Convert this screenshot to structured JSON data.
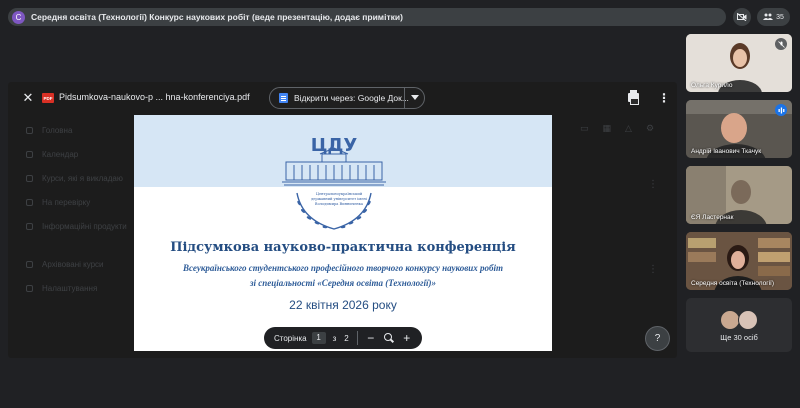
{
  "meeting": {
    "avatar_letter": "С",
    "title": "Середня освіта (Технології) Конкурс наукових робіт (веде презентацію, додає примітки)",
    "participant_count": "35"
  },
  "background": {
    "items": [
      "Головна",
      "Календар",
      "Курси, які я викладаю",
      "На перевірку",
      "Інформаційні продукти",
      "Архівовані курси",
      "Налаштування"
    ]
  },
  "viewer": {
    "filename": "Pidsumkova-naukovo-p ... hna-konferenciya.pdf",
    "pdf_badge": "PDF",
    "open_with": "Відкрити через: Google Док...",
    "page_label": "Сторінка",
    "current_page": "1",
    "of_label": "з",
    "total_pages": "2",
    "minus": "−",
    "plus": "+",
    "help": "?"
  },
  "slide": {
    "logo_text": "ЦДУ",
    "logo_caption_1": "Центральноукраїнський",
    "logo_caption_2": "державний університет імені",
    "logo_caption_3": "Володимира Винниченка",
    "title": "Підсумкова науково-практична конференція",
    "subtitle_1": "Всеукраїнського студентського професійного творчого конкурсу наукових робіт",
    "subtitle_2": "зі спеціальності «Середня освіта (Технології)»",
    "date": "22 квітня 2026 року"
  },
  "participants": [
    {
      "name": "Ольга Курило",
      "bg": "#dcd6cf"
    },
    {
      "name": "Андрій Іванович Ткачук",
      "bg": "#4a4640"
    },
    {
      "name": "ЄЯ Ластернак",
      "bg": "#6e6758"
    },
    {
      "name": "Середня освіта (Технології)",
      "bg": "#7a6048"
    }
  ],
  "more_people": "Ще 30 осіб"
}
